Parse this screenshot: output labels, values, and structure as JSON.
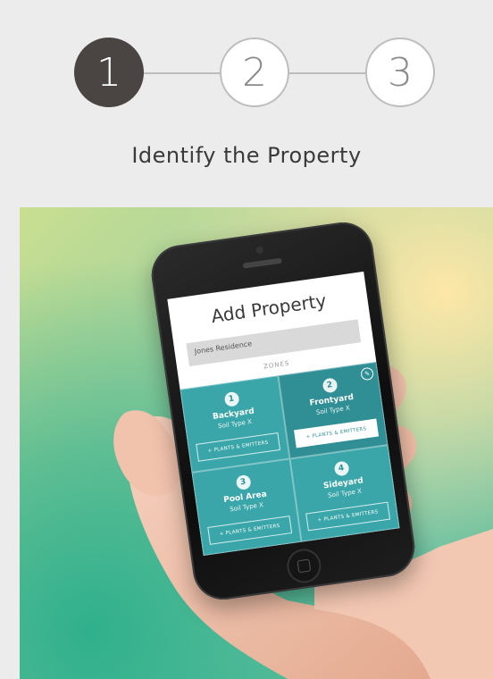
{
  "steps": [
    {
      "label": "1",
      "state": "active"
    },
    {
      "label": "2",
      "state": "inactive"
    },
    {
      "label": "3",
      "state": "inactive"
    }
  ],
  "heading": "Identify the Property",
  "phone_screen": {
    "title": "Add Property",
    "property_name": "Jones Residence",
    "zones_label": "ZONES",
    "zones": [
      {
        "number": "1",
        "name": "Backyard",
        "soil": "Soil Type X",
        "button": "+ PLANTS & EMITTERS"
      },
      {
        "number": "2",
        "name": "Frontyard",
        "soil": "Soil Type X",
        "button": "+ PLANTS & EMITTERS"
      },
      {
        "number": "3",
        "name": "Pool Area",
        "soil": "Soil Type X",
        "button": "+ PLANTS & EMITTERS"
      },
      {
        "number": "4",
        "name": "Sideyard",
        "soil": "Soil Type X",
        "button": "+ PLANTS & EMITTERS"
      }
    ]
  },
  "colors": {
    "step_active": "#4a4543",
    "step_inactive_text": "#8a8a8a",
    "zone_teal": "#3aa6a9",
    "zone_teal_dark": "#2f8f95"
  },
  "icons": {
    "edit": "pencil-icon"
  }
}
